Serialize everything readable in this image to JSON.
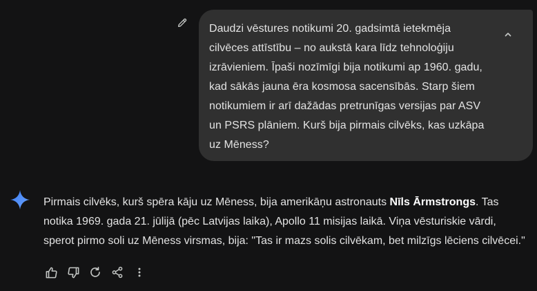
{
  "user_message": {
    "text": "Daudzi vēstures notikumi 20. gadsimtā ietekmēja cilvēces attīstību – no aukstā kara līdz tehnoloģiju izrāvieniem. Īpaši nozīmīgi bija notikumi ap 1960. gadu, kad sākās jauna ēra kosmosa sacensībās. Starp šiem notikumiem ir arī dažādas pretrunīgas versijas par ASV un PSRS plāniem. Kurš bija pirmais cilvēks, kas uzkāpa uz Mēness?",
    "edit_icon": "pencil-icon",
    "collapse_icon": "chevron-up-icon"
  },
  "response": {
    "assistant_icon": "gemini-sparkle-icon",
    "text_before": "Pirmais cilvēks, kurš spēra kāju uz Mēness, bija amerikāņu astronauts ",
    "text_bold": "Nīls Ārmstrongs",
    "text_after": ". Tas notika 1969. gada 21. jūlijā (pēc Latvijas laika), Apollo 11 misijas laikā. Viņa vēsturiskie vārdi, sperot pirmo soli uz Mēness virsmas, bija: \"Tas ir mazs solis cilvēkam, bet milzīgs lēciens cilvēcei.\""
  },
  "actions": [
    {
      "name": "thumbs-up-icon"
    },
    {
      "name": "thumbs-down-icon"
    },
    {
      "name": "regenerate-icon"
    },
    {
      "name": "share-icon"
    },
    {
      "name": "more-options-icon"
    }
  ],
  "colors": {
    "background": "#131314",
    "bubble": "#303030",
    "text": "#e3e3e3",
    "icon": "#c4c7c5",
    "gemini_blue": "#4c8df6"
  }
}
